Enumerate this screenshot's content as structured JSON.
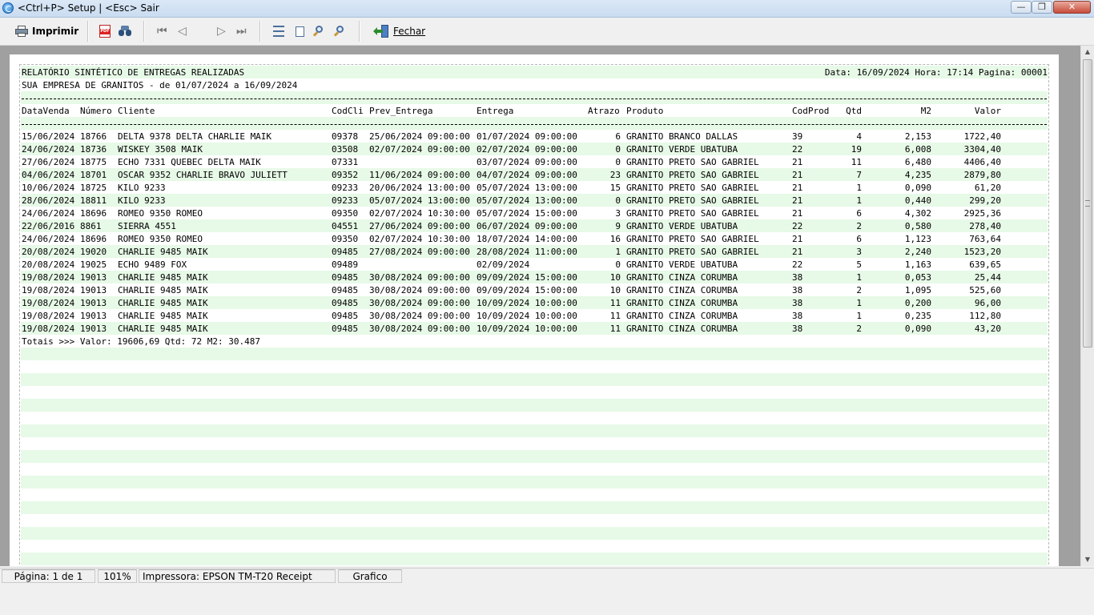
{
  "window": {
    "title": "<Ctrl+P> Setup | <Esc> Sair",
    "min_glyph": "—",
    "max_glyph": "❐",
    "close_glyph": "✕"
  },
  "toolbar": {
    "print_label": "Imprimir",
    "close_label": "Fechar",
    "pdf_text": "PDF",
    "nav_first": "⏮",
    "nav_prev": "◁",
    "nav_next": "▷",
    "nav_last": "⏭"
  },
  "report": {
    "title": "RELATÓRIO SINTÉTICO DE ENTREGAS REALIZADAS",
    "header_right": "Data: 16/09/2024 Hora: 17:14 Pagina: 00001",
    "subtitle": "SUA EMPRESA DE GRANITOS - de 01/07/2024 a 16/09/2024",
    "columns": {
      "data_venda": "DataVenda",
      "numero": "Número",
      "cliente": "Cliente",
      "codcli": "CodCli",
      "prev_entrega": "Prev_Entrega",
      "entrega": "Entrega",
      "atrazo": "Atrazo",
      "produto": "Produto",
      "codprod": "CodProd",
      "qtd": "Qtd",
      "m2": "M2",
      "valor": "Valor"
    },
    "rows": [
      [
        "15/06/2024",
        "18766",
        "DELTA 9378 DELTA CHARLIE MAIK",
        "09378",
        "25/06/2024 09:00:00",
        "01/07/2024 09:00:00",
        "6",
        "GRANITO BRANCO DALLAS",
        "39",
        "4",
        "2,153",
        "1722,40"
      ],
      [
        "24/06/2024",
        "18736",
        "WISKEY 3508 MAIK",
        "03508",
        "02/07/2024 09:00:00",
        "02/07/2024 09:00:00",
        "0",
        "GRANITO VERDE UBATUBA",
        "22",
        "19",
        "6,008",
        "3304,40"
      ],
      [
        "27/06/2024",
        "18775",
        "ECHO 7331 QUEBEC DELTA MAIK",
        "07331",
        "",
        "03/07/2024 09:00:00",
        "0",
        "GRANITO PRETO SAO GABRIEL",
        "21",
        "11",
        "6,480",
        "4406,40"
      ],
      [
        "04/06/2024",
        "18701",
        "OSCAR 9352 CHARLIE BRAVO JULIETT",
        "09352",
        "11/06/2024 09:00:00",
        "04/07/2024 09:00:00",
        "23",
        "GRANITO PRETO SAO GABRIEL",
        "21",
        "7",
        "4,235",
        "2879,80"
      ],
      [
        "10/06/2024",
        "18725",
        "KILO 9233",
        "09233",
        "20/06/2024 13:00:00",
        "05/07/2024 13:00:00",
        "15",
        "GRANITO PRETO SAO GABRIEL",
        "21",
        "1",
        "0,090",
        "61,20"
      ],
      [
        "28/06/2024",
        "18811",
        "KILO 9233",
        "09233",
        "05/07/2024 13:00:00",
        "05/07/2024 13:00:00",
        "0",
        "GRANITO PRETO SAO GABRIEL",
        "21",
        "1",
        "0,440",
        "299,20"
      ],
      [
        "24/06/2024",
        "18696",
        "ROMEO 9350 ROMEO",
        "09350",
        "02/07/2024 10:30:00",
        "05/07/2024 15:00:00",
        "3",
        "GRANITO PRETO SAO GABRIEL",
        "21",
        "6",
        "4,302",
        "2925,36"
      ],
      [
        "22/06/2016",
        "8861",
        "SIERRA 4551",
        "04551",
        "27/06/2024 09:00:00",
        "06/07/2024 09:00:00",
        "9",
        "GRANITO VERDE UBATUBA",
        "22",
        "2",
        "0,580",
        "278,40"
      ],
      [
        "24/06/2024",
        "18696",
        "ROMEO 9350 ROMEO",
        "09350",
        "02/07/2024 10:30:00",
        "18/07/2024 14:00:00",
        "16",
        "GRANITO PRETO SAO GABRIEL",
        "21",
        "6",
        "1,123",
        "763,64"
      ],
      [
        "20/08/2024",
        "19020",
        "CHARLIE 9485 MAIK",
        "09485",
        "27/08/2024 09:00:00",
        "28/08/2024 11:00:00",
        "1",
        "GRANITO PRETO SAO GABRIEL",
        "21",
        "3",
        "2,240",
        "1523,20"
      ],
      [
        "20/08/2024",
        "19025",
        "ECHO 9489 FOX",
        "09489",
        "",
        "02/09/2024",
        "0",
        "GRANITO VERDE UBATUBA",
        "22",
        "5",
        "1,163",
        "639,65"
      ],
      [
        "19/08/2024",
        "19013",
        "CHARLIE 9485 MAIK",
        "09485",
        "30/08/2024 09:00:00",
        "09/09/2024 15:00:00",
        "10",
        "GRANITO CINZA CORUMBA",
        "38",
        "1",
        "0,053",
        "25,44"
      ],
      [
        "19/08/2024",
        "19013",
        "CHARLIE 9485 MAIK",
        "09485",
        "30/08/2024 09:00:00",
        "09/09/2024 15:00:00",
        "10",
        "GRANITO CINZA CORUMBA",
        "38",
        "2",
        "1,095",
        "525,60"
      ],
      [
        "19/08/2024",
        "19013",
        "CHARLIE 9485 MAIK",
        "09485",
        "30/08/2024 09:00:00",
        "10/09/2024 10:00:00",
        "11",
        "GRANITO CINZA CORUMBA",
        "38",
        "1",
        "0,200",
        "96,00"
      ],
      [
        "19/08/2024",
        "19013",
        "CHARLIE 9485 MAIK",
        "09485",
        "30/08/2024 09:00:00",
        "10/09/2024 10:00:00",
        "11",
        "GRANITO CINZA CORUMBA",
        "38",
        "1",
        "0,235",
        "112,80"
      ],
      [
        "19/08/2024",
        "19013",
        "CHARLIE 9485 MAIK",
        "09485",
        "30/08/2024 09:00:00",
        "10/09/2024 10:00:00",
        "11",
        "GRANITO CINZA CORUMBA",
        "38",
        "2",
        "0,090",
        "43,20"
      ]
    ],
    "totals": "Totais >>> Valor: 19606,69 Qtd: 72 M2: 30.487"
  },
  "statusbar": {
    "page": "Página: 1 de 1",
    "zoom": "101%",
    "printer": "Impressora: EPSON TM-T20 Receipt",
    "mode": "Grafico"
  },
  "colors": {
    "band": "#e7f9e7",
    "preview_bg": "#a0a0a0",
    "titlebar": "#c9dcf1"
  },
  "icons": [
    "app-icon",
    "printer-icon",
    "pdf-icon",
    "binoculars-icon",
    "first-page-icon",
    "prev-page-icon",
    "next-page-icon",
    "last-page-icon",
    "fit-width-icon",
    "full-page-icon",
    "zoom-in-icon",
    "zoom-out-icon",
    "close-door-icon"
  ]
}
